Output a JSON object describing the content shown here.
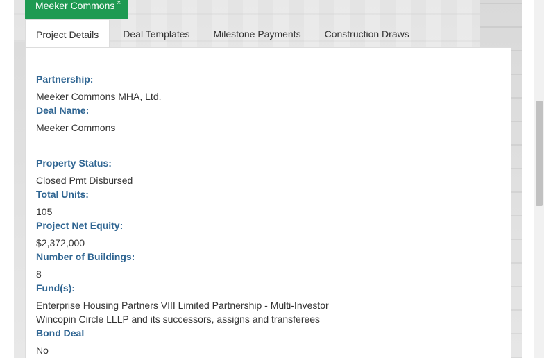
{
  "deal_tab": {
    "title": "Meeker Commons",
    "close_glyph": "×"
  },
  "tabs": [
    {
      "label": "Project Details",
      "active": true
    },
    {
      "label": "Deal Templates",
      "active": false
    },
    {
      "label": "Milestone Payments",
      "active": false
    },
    {
      "label": "Construction Draws",
      "active": false
    }
  ],
  "details": {
    "partnership_label": "Partnership:",
    "partnership_value": "Meeker Commons MHA, Ltd.",
    "deal_name_label": "Deal Name:",
    "deal_name_value": "Meeker Commons",
    "property_status_label": "Property Status:",
    "property_status_value": "Closed Pmt Disbursed",
    "total_units_label": "Total Units:",
    "total_units_value": "105",
    "net_equity_label": "Project Net Equity:",
    "net_equity_value": "$2,372,000",
    "buildings_label": "Number of Buildings:",
    "buildings_value": "8",
    "funds_label": "Fund(s):",
    "funds_value_1": "Enterprise Housing Partners VIII Limited Partnership - Multi-Investor",
    "funds_value_2": "Wincopin Circle LLLP and its successors, assigns and transferees",
    "bond_label": "Bond Deal",
    "bond_value": "No"
  },
  "colors": {
    "accent_green": "#1e9a52",
    "label_blue": "#2f6592",
    "text": "#333333"
  }
}
